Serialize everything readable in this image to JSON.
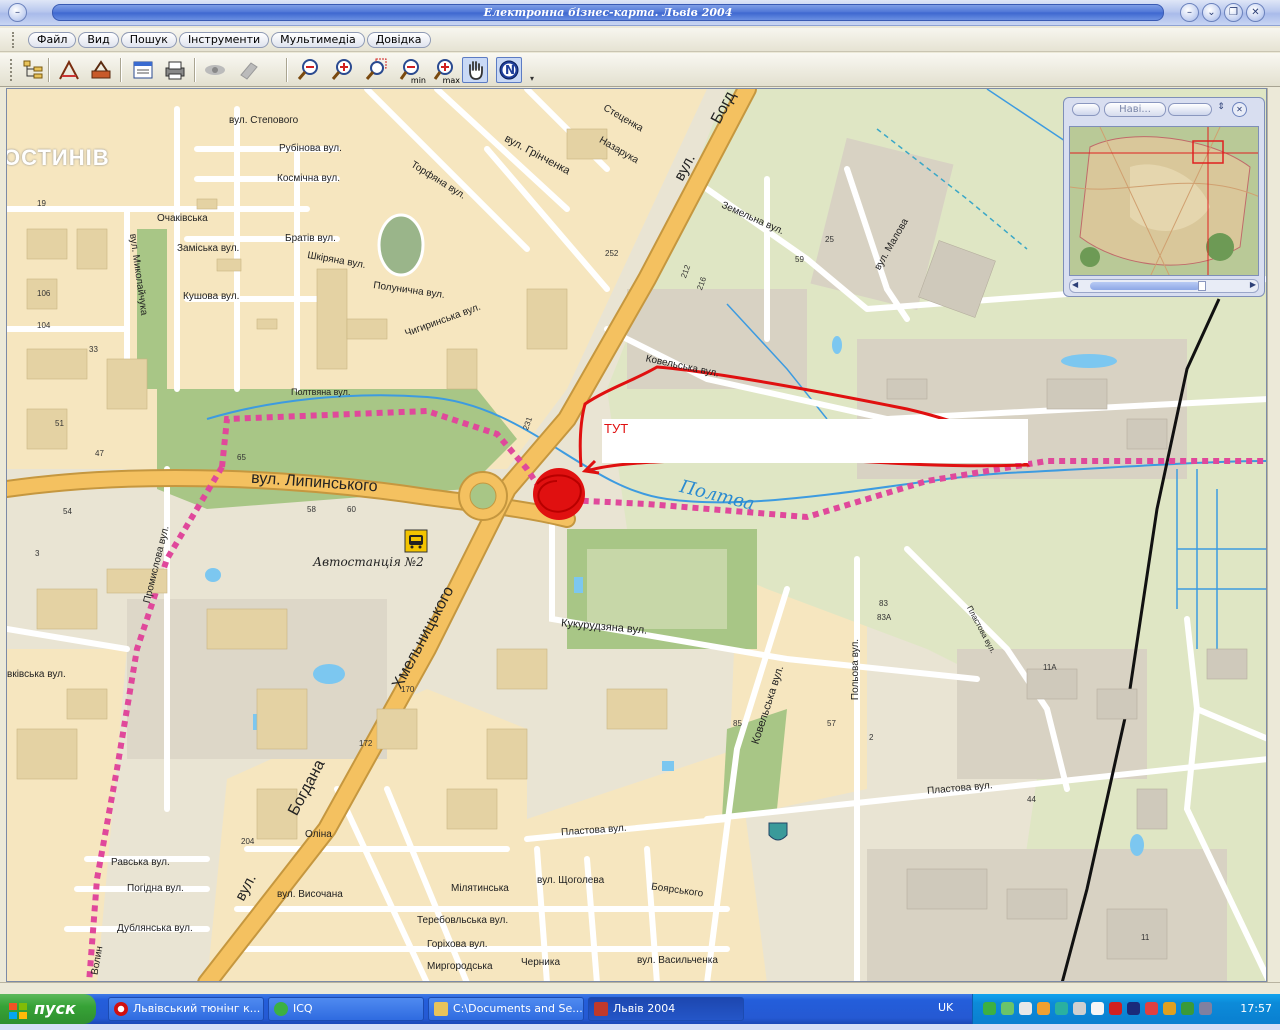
{
  "window": {
    "title": "Електронна бізнес-карта. Львів 2004",
    "controls": {
      "minimize": "–",
      "restore": "❐",
      "close": "✕",
      "rollup": "⌄"
    }
  },
  "menu": {
    "items": [
      "Файл",
      "Вид",
      "Пошук",
      "Інструменти",
      "Мультимедіа",
      "Довідка"
    ]
  },
  "toolbar": {
    "zoom_min_label": "min",
    "zoom_max_label": "max",
    "compass_label": "N"
  },
  "map": {
    "district": "ОСТИНІВ",
    "streets": {
      "lypynskoho": "вул.   Липинського",
      "khmelnytskoho": "Хмельницького",
      "bohdana": "Богдана",
      "vul_main": "вул.",
      "bohd_top": "Богд",
      "vul_top": "вул.",
      "stepovoho": "вул. Степового",
      "rubinova": "Рубінова вул.",
      "kosmichna": "Космічна вул.",
      "ochakivska": "Очаківська",
      "bratia": "Братів вул.",
      "zamiska": "Заміська вул.",
      "shkiriana": "Шкіряна вул.",
      "kushova": "Кушова вул.",
      "polunychna": "Полунична вул.",
      "chyhyrynska": "Чигиринська вул.",
      "hrinchenka": "вул. Грінченка",
      "stecenka": "Стеценка",
      "nazaruka": "Назарука",
      "torfiana": "Торфяна вул.",
      "kovelska_top": "Ковельська вул.",
      "kovelska_right": "Ковельська вул.",
      "zemelna": "Земельна вул.",
      "malova": "вул. Малова",
      "poltva_val": "Полтвяна вул.",
      "kukurudziana": "Кукурудзяна вул.",
      "polova": "Польова вул.",
      "plastova": "Пластова вул.",
      "plastova_right": "Пластова вул.",
      "plastova_vert": "Пластова вул.",
      "promyslova": "Промислова вул.",
      "mykolaichuka": "вул. Миколайчука",
      "kovel_left": "вківська вул.",
      "volyn": "Волин",
      "ravska": "Равська вул.",
      "pohidna": "Погідна вул.",
      "dublianska": "Дублянська вул.",
      "olina": "Оліна",
      "vysochana": "вул. Височана",
      "milyatynska": "Мілятинська",
      "terebovlianska": "Теребовльська вул.",
      "horikhova": "Горіхова вул.",
      "myrhorodska": "Миргородська",
      "shchoholeva": "вул. Щоголева",
      "boiarska": "Боярського",
      "vasylchenka": "вул. Васильченка",
      "chernyka": "Черника",
      "bus_station": "Автостанція №2"
    },
    "river": "Полтва",
    "annotation": "ТУТ",
    "house_numbers": [
      "54",
      "58",
      "60",
      "65",
      "170",
      "172",
      "204",
      "212",
      "216",
      "231",
      "252",
      "11А",
      "83А",
      "57",
      "85",
      "44",
      "11",
      "2",
      "83",
      "106",
      "104",
      "19",
      "33",
      "51",
      "47",
      "25",
      "59",
      "3"
    ]
  },
  "navigator": {
    "title": "Наві..."
  },
  "taskbar": {
    "start": "пуск",
    "tasks": [
      "Львівський тюнінг к...",
      "ICQ",
      "C:\\Documents and Se...",
      "Львів 2004"
    ],
    "language": "UK",
    "clock": "17:57"
  },
  "colors": {
    "road_major": "#f4c160",
    "road_minor": "#ffffff",
    "block": "#f6e7c2",
    "industrial": "#d9d4c6",
    "park": "#a9c78a",
    "river": "#3d9be0",
    "boundary": "#e0489b",
    "annotation": "#e01010"
  }
}
